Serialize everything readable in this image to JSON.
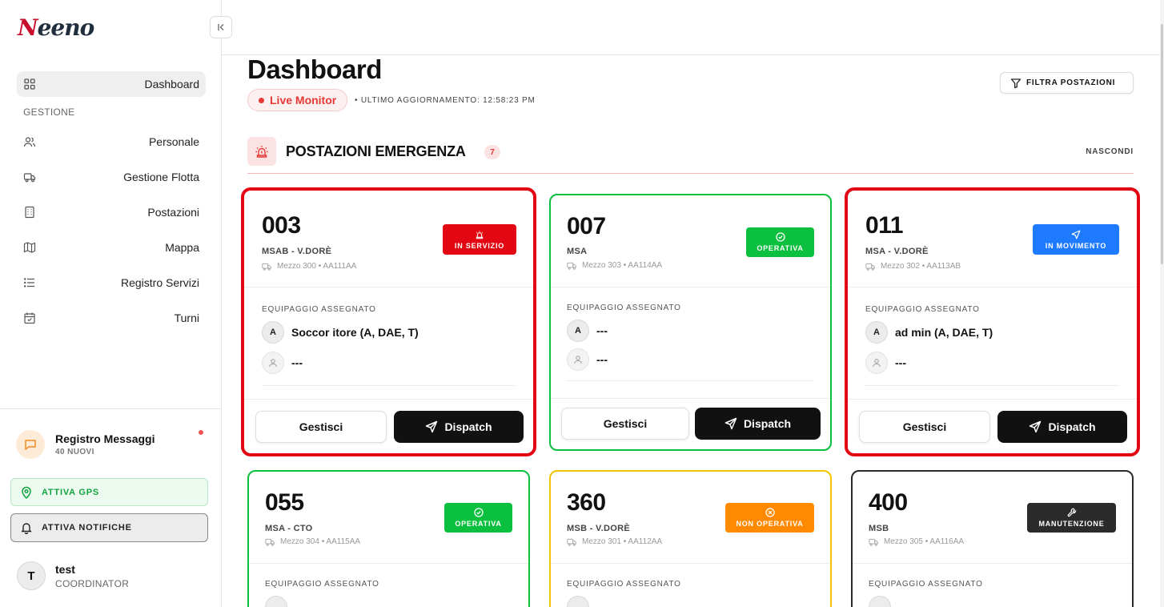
{
  "app": {
    "logo": "Neeno"
  },
  "sidebar": {
    "dashboard": "Dashboard",
    "section_label": "GESTIONE",
    "items": [
      {
        "label": "Personale",
        "icon": "users-icon"
      },
      {
        "label": "Gestione Flotta",
        "icon": "truck-icon"
      },
      {
        "label": "Postazioni",
        "icon": "building-icon"
      },
      {
        "label": "Mappa",
        "icon": "map-icon"
      },
      {
        "label": "Registro Servizi",
        "icon": "list-icon"
      },
      {
        "label": "Turni",
        "icon": "calendar-icon"
      }
    ],
    "messages": {
      "title": "Registro Messaggi",
      "subtitle": "40 NUOVI"
    },
    "gps_button": "ATTIVA GPS",
    "notifications_button": "ATTIVA NOTIFICHE",
    "user": {
      "initial": "T",
      "name": "test",
      "role": "COORDINATOR"
    }
  },
  "header": {
    "title": "Dashboard",
    "live_label": "Live Monitor",
    "last_update": "• ULTIMO AGGIORNAMENTO: 12:58:23 PM",
    "filter_button": "FILTRA POSTAZIONI"
  },
  "section": {
    "title": "POSTAZIONI EMERGENZA",
    "count": "7",
    "hide_label": "NASCONDI"
  },
  "colors": {
    "alert_red": "#e30613",
    "operativa_green": "#0bbf3f",
    "movimento_blue": "#1e7bff",
    "non_operativa_orange": "#ff8a00",
    "manutenzione_dark": "#2b2b2b"
  },
  "cards": [
    {
      "code": "003",
      "type": "MSAB - V.DORÈ",
      "vehicle": "Mezzo 300 • AA111AA",
      "status": "IN SERVIZIO",
      "status_icon": "siren-icon",
      "crew_label": "EQUIPAGGIO ASSEGNATO",
      "crew": [
        {
          "avatar": "A",
          "name": "Soccor itore (A, DAE, T)"
        },
        {
          "avatar": "",
          "name": "---"
        }
      ],
      "manage": "Gestisci",
      "dispatch": "Dispatch"
    },
    {
      "code": "007",
      "type": "MSA",
      "vehicle": "Mezzo 303 • AA114AA",
      "status": "OPERATIVA",
      "status_icon": "check-circle-icon",
      "crew_label": "EQUIPAGGIO ASSEGNATO",
      "crew": [
        {
          "avatar": "A",
          "name": "---"
        },
        {
          "avatar": "",
          "name": "---"
        }
      ],
      "manage": "Gestisci",
      "dispatch": "Dispatch"
    },
    {
      "code": "011",
      "type": "MSA - V.DORÈ",
      "vehicle": "Mezzo 302 • AA113AB",
      "status": "IN MOVIMENTO",
      "status_icon": "navigation-icon",
      "crew_label": "EQUIPAGGIO ASSEGNATO",
      "crew": [
        {
          "avatar": "A",
          "name": "ad min (A, DAE, T)"
        },
        {
          "avatar": "",
          "name": "---"
        }
      ],
      "manage": "Gestisci",
      "dispatch": "Dispatch"
    },
    {
      "code": "055",
      "type": "MSA - CTO",
      "vehicle": "Mezzo 304 • AA115AA",
      "status": "OPERATIVA",
      "status_icon": "check-circle-icon",
      "crew_label": "EQUIPAGGIO ASSEGNATO"
    },
    {
      "code": "360",
      "type": "MSB - V.DORÈ",
      "vehicle": "Mezzo 301 • AA112AA",
      "status": "NON OPERATIVA",
      "status_icon": "x-circle-icon",
      "crew_label": "EQUIPAGGIO ASSEGNATO"
    },
    {
      "code": "400",
      "type": "MSB",
      "vehicle": "Mezzo 305 • AA116AA",
      "status": "MANUTENZIONE",
      "status_icon": "wrench-icon",
      "crew_label": "EQUIPAGGIO ASSEGNATO"
    }
  ]
}
